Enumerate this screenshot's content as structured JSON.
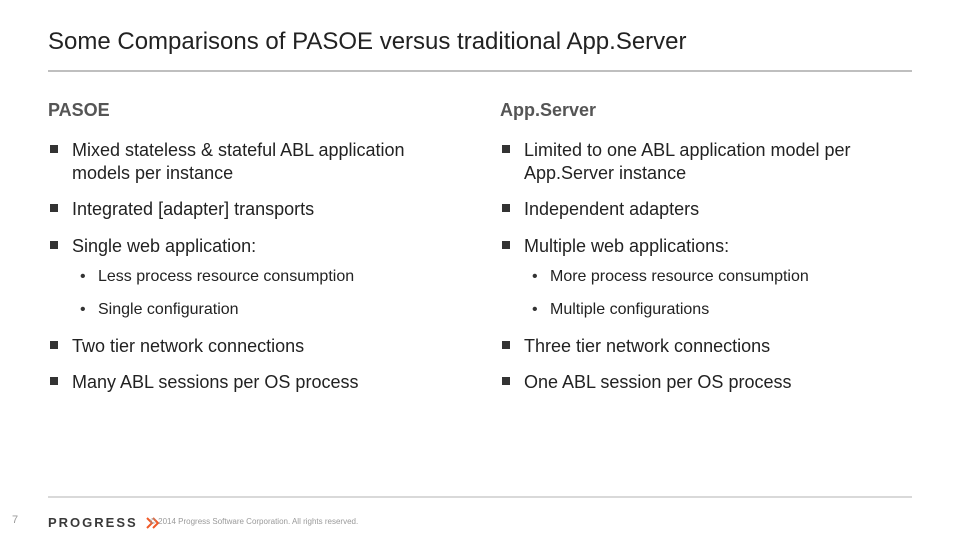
{
  "title": "Some Comparisons of PASOE versus traditional App.Server",
  "left": {
    "header": "PASOE",
    "b1": "Mixed stateless & stateful ABL application models per instance",
    "b2": "Integrated [adapter] transports",
    "b3": "Single web application:",
    "b3s1": "Less process resource consumption",
    "b3s2": "Single configuration",
    "b4": "Two tier network connections",
    "b5": "Many ABL sessions per OS process"
  },
  "right": {
    "header": "App.Server",
    "b1": "Limited to one ABL application model per App.Server instance",
    "b2": "Independent adapters",
    "b3": "Multiple web applications:",
    "b3s1": "More process resource consumption",
    "b3s2": "Multiple configurations",
    "b4": "Three tier network connections",
    "b5": "One ABL session per OS process"
  },
  "footer": {
    "page": "7",
    "brand": "PROGRESS",
    "copyright": "© 2014 Progress Software Corporation. All rights reserved."
  },
  "colors": {
    "accent": "#f05a28"
  }
}
